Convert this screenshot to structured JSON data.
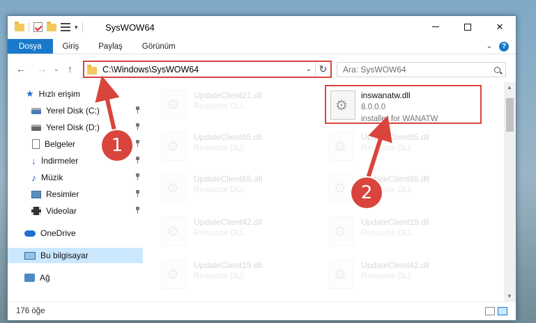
{
  "window": {
    "title": "SysWOW64",
    "minimize_label": "",
    "close_label": "✕"
  },
  "ribbon": {
    "tabs": [
      "Dosya",
      "Giriş",
      "Paylaş",
      "Görünüm"
    ],
    "help_label": "?"
  },
  "nav": {
    "address": "C:\\Windows\\SysWOW64",
    "search_placeholder": "Ara: SysWOW64"
  },
  "sidebar": {
    "quick_access": "Hızlı erişim",
    "items": [
      "Yerel Disk (C:)",
      "Yerel Disk (D:)",
      "Belgeler",
      "İndirmeler",
      "Müzik",
      "Resimler",
      "Videolar"
    ],
    "onedrive": "OneDrive",
    "this_pc": "Bu bilgisayar",
    "network": "Ağ"
  },
  "files": {
    "left_column": [
      {
        "name": "UpdateClient21.dll",
        "type": "Resource DLL"
      },
      {
        "name": "UpdateClient65.dll",
        "type": "Resource DLL"
      },
      {
        "name": "UpdateClient65.dll",
        "type": "Resource DLL"
      },
      {
        "name": "UpdateClient42.dll",
        "type": "Resource DLL"
      },
      {
        "name": "UpdateClient19.dll",
        "type": "Resource DLL"
      }
    ],
    "highlighted": {
      "name": "inswanatw.dll",
      "version": "8.0.0.0",
      "description": "installer for WANATW"
    },
    "right_column": [
      {
        "name": "UpdateClient65.dll",
        "type": "Resource DLL"
      },
      {
        "name": "UpdateClient65.dll",
        "type": "Resource DLL"
      },
      {
        "name": "UpdateClient19.dll",
        "type": "Resource DLL"
      },
      {
        "name": "UpdateClient42.dll",
        "type": "Resource DLL"
      }
    ]
  },
  "status": {
    "count": "176 öğe"
  },
  "callouts": [
    "1",
    "2"
  ],
  "colors": {
    "accent": "#1979ca",
    "highlight": "#d9443c",
    "selected": "#cce8ff"
  }
}
